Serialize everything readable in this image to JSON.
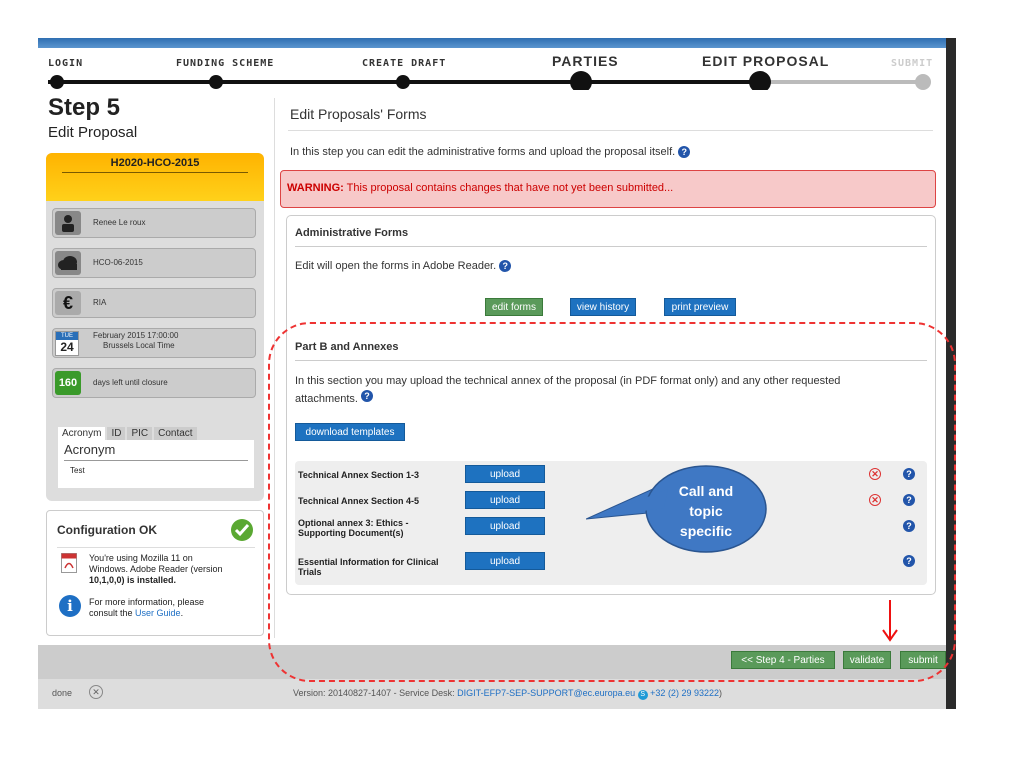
{
  "wizard": {
    "steps": [
      {
        "label": "LOGIN"
      },
      {
        "label": "FUNDING SCHEME"
      },
      {
        "label": "CREATE DRAFT"
      },
      {
        "label": "PARTIES"
      },
      {
        "label": "EDIT PROPOSAL"
      },
      {
        "label": "SUBMIT"
      }
    ]
  },
  "left": {
    "step_title": "Step 5",
    "step_subtitle": "Edit Proposal",
    "call_name": "H2020-HCO-2015",
    "info": [
      {
        "icon": "person-icon",
        "text": "Renee Le roux"
      },
      {
        "icon": "cloud-icon",
        "text": "HCO-06-2015"
      },
      {
        "icon": "euro-icon",
        "text": "RIA"
      },
      {
        "icon": "calendar-icon",
        "day": "TUE",
        "date": "24",
        "text": "February 2015  17:00:00",
        "text2": "Brussels Local Time"
      },
      {
        "icon": "counter-icon",
        "count": "160",
        "text": "days left until closure"
      }
    ],
    "tabs": [
      "Acronym",
      "ID",
      "PIC",
      "Contact"
    ],
    "acronym_heading": "Acronym",
    "acronym_value": "Test",
    "config": {
      "title": "Configuration OK",
      "line1": "You're using Mozilla 11 on",
      "line2": "Windows. Adobe Reader (version",
      "line3": "10,1,0,0) is installed.",
      "line4": "For more information, please",
      "line5_prefix": "consult the ",
      "link": "User Guide",
      "line5_suffix": "."
    }
  },
  "main": {
    "title": "Edit Proposals' Forms",
    "intro": "In this step you can edit the administrative forms and upload the proposal itself.",
    "warning_label": "WARNING:",
    "warning_text": " This proposal contains changes that have not yet been submitted...",
    "admin": {
      "title": "Administrative Forms",
      "desc": "Edit will open the forms in Adobe Reader.",
      "buttons": {
        "edit": "edit forms",
        "history": "view history",
        "preview": "print preview"
      }
    },
    "partb": {
      "title": "Part B and Annexes",
      "desc1": "In this section you may upload the technical annex of the proposal (in PDF format only) and any other requested",
      "desc2": "attachments.",
      "download": "download templates",
      "docs": [
        {
          "line1": "Technical Annex Section 1-3",
          "line2": "",
          "button": "upload",
          "removable": true
        },
        {
          "line1": "Technical Annex Section 4-5",
          "line2": "",
          "button": "upload",
          "removable": true
        },
        {
          "line1": "Optional annex 3: Ethics -",
          "line2": "Supporting Document(s)",
          "button": "upload",
          "removable": false
        },
        {
          "line1": "Essential Information for Clinical",
          "line2": "Trials",
          "button": "upload",
          "removable": false
        }
      ]
    }
  },
  "callout": {
    "line1": "Call and",
    "line2": "topic",
    "line3": "specific"
  },
  "footer": {
    "prev": "<< Step 4 - Parties",
    "validate": "validate",
    "submit": "submit"
  },
  "status": {
    "left": "done",
    "version": "Version: 20140827-1407 - Service Desk: ",
    "email": "DIGIT-EFP7-SEP-SUPPORT@ec.europa.eu",
    "phone": "+32 (2) 29 93222",
    "close_paren": ")"
  }
}
